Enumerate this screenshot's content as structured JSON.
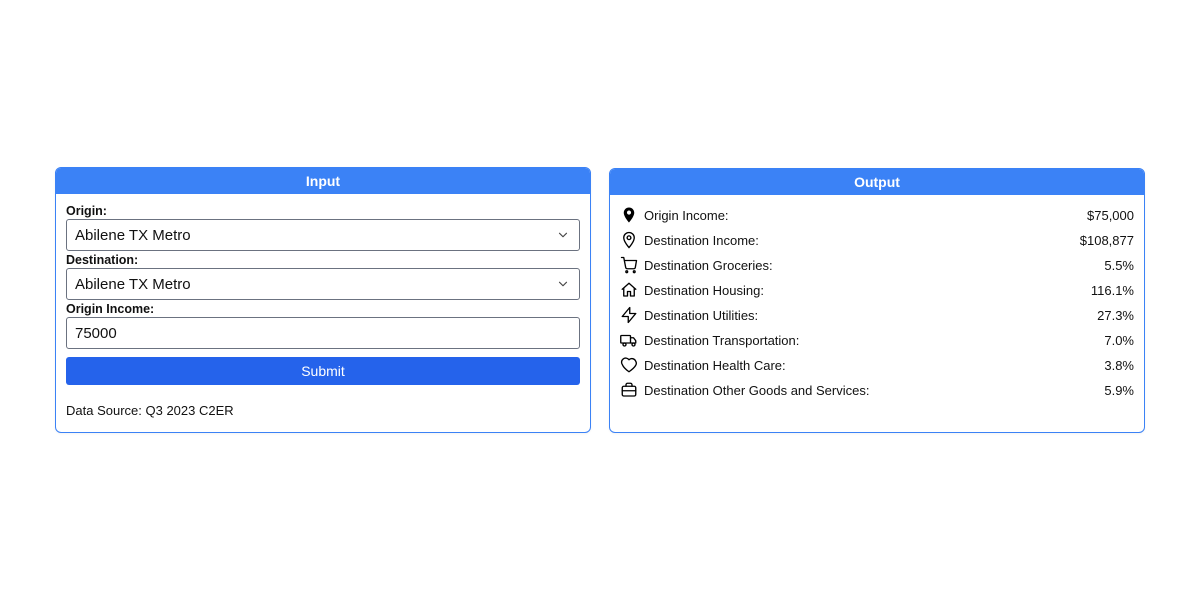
{
  "input": {
    "header": "Input",
    "origin_label": "Origin:",
    "origin_value": "Abilene TX Metro",
    "destination_label": "Destination:",
    "destination_value": "Abilene TX Metro",
    "income_label": "Origin Income:",
    "income_value": "75000",
    "submit_label": "Submit",
    "data_source": "Data Source: Q3 2023 C2ER"
  },
  "output": {
    "header": "Output",
    "rows": [
      {
        "icon": "map-pin-filled",
        "label": "Origin Income:",
        "value": "$75,000"
      },
      {
        "icon": "map-pin-outline",
        "label": "Destination Income:",
        "value": "$108,877"
      },
      {
        "icon": "cart",
        "label": "Destination Groceries:",
        "value": "5.5%"
      },
      {
        "icon": "home",
        "label": "Destination Housing:",
        "value": "116.1%"
      },
      {
        "icon": "bolt",
        "label": "Destination Utilities:",
        "value": "27.3%"
      },
      {
        "icon": "truck",
        "label": "Destination Transportation:",
        "value": "7.0%"
      },
      {
        "icon": "heart",
        "label": "Destination Health Care:",
        "value": "3.8%"
      },
      {
        "icon": "briefcase",
        "label": "Destination Other Goods and Services:",
        "value": "5.9%"
      }
    ]
  }
}
